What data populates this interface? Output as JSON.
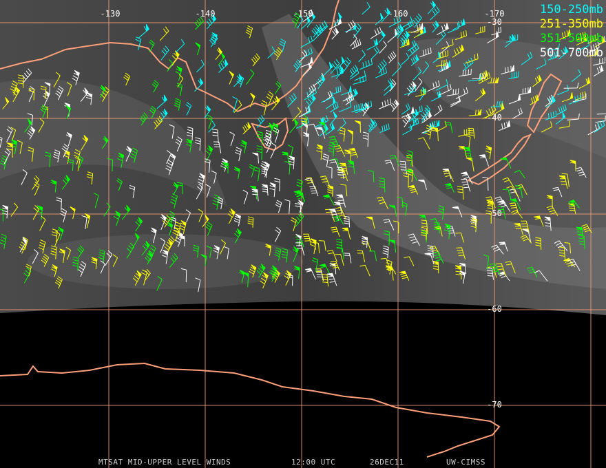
{
  "legend": [
    {
      "label": "150-250mb",
      "color": "#00ffff"
    },
    {
      "label": "251-350mb",
      "color": "#ffff00"
    },
    {
      "label": "351-500mb",
      "color": "#00ff00"
    },
    {
      "label": "501-700mb",
      "color": "#ffffff"
    }
  ],
  "grid": {
    "color": "#ffa07a",
    "lon_labels": [
      "-130",
      "-140",
      "-150",
      "-160",
      "-170"
    ],
    "lat_labels": [
      "-30",
      "-40",
      "-50",
      "-60",
      "-70"
    ]
  },
  "caption": {
    "product": "MTSAT MID-UPPER LEVEL WINDS",
    "time": "12:00 UTC",
    "date": "26DEC11",
    "source": "UW-CIMSS"
  },
  "coastlines": [
    "Australia",
    "Tasmania",
    "New Zealand",
    "Antarctica"
  ]
}
